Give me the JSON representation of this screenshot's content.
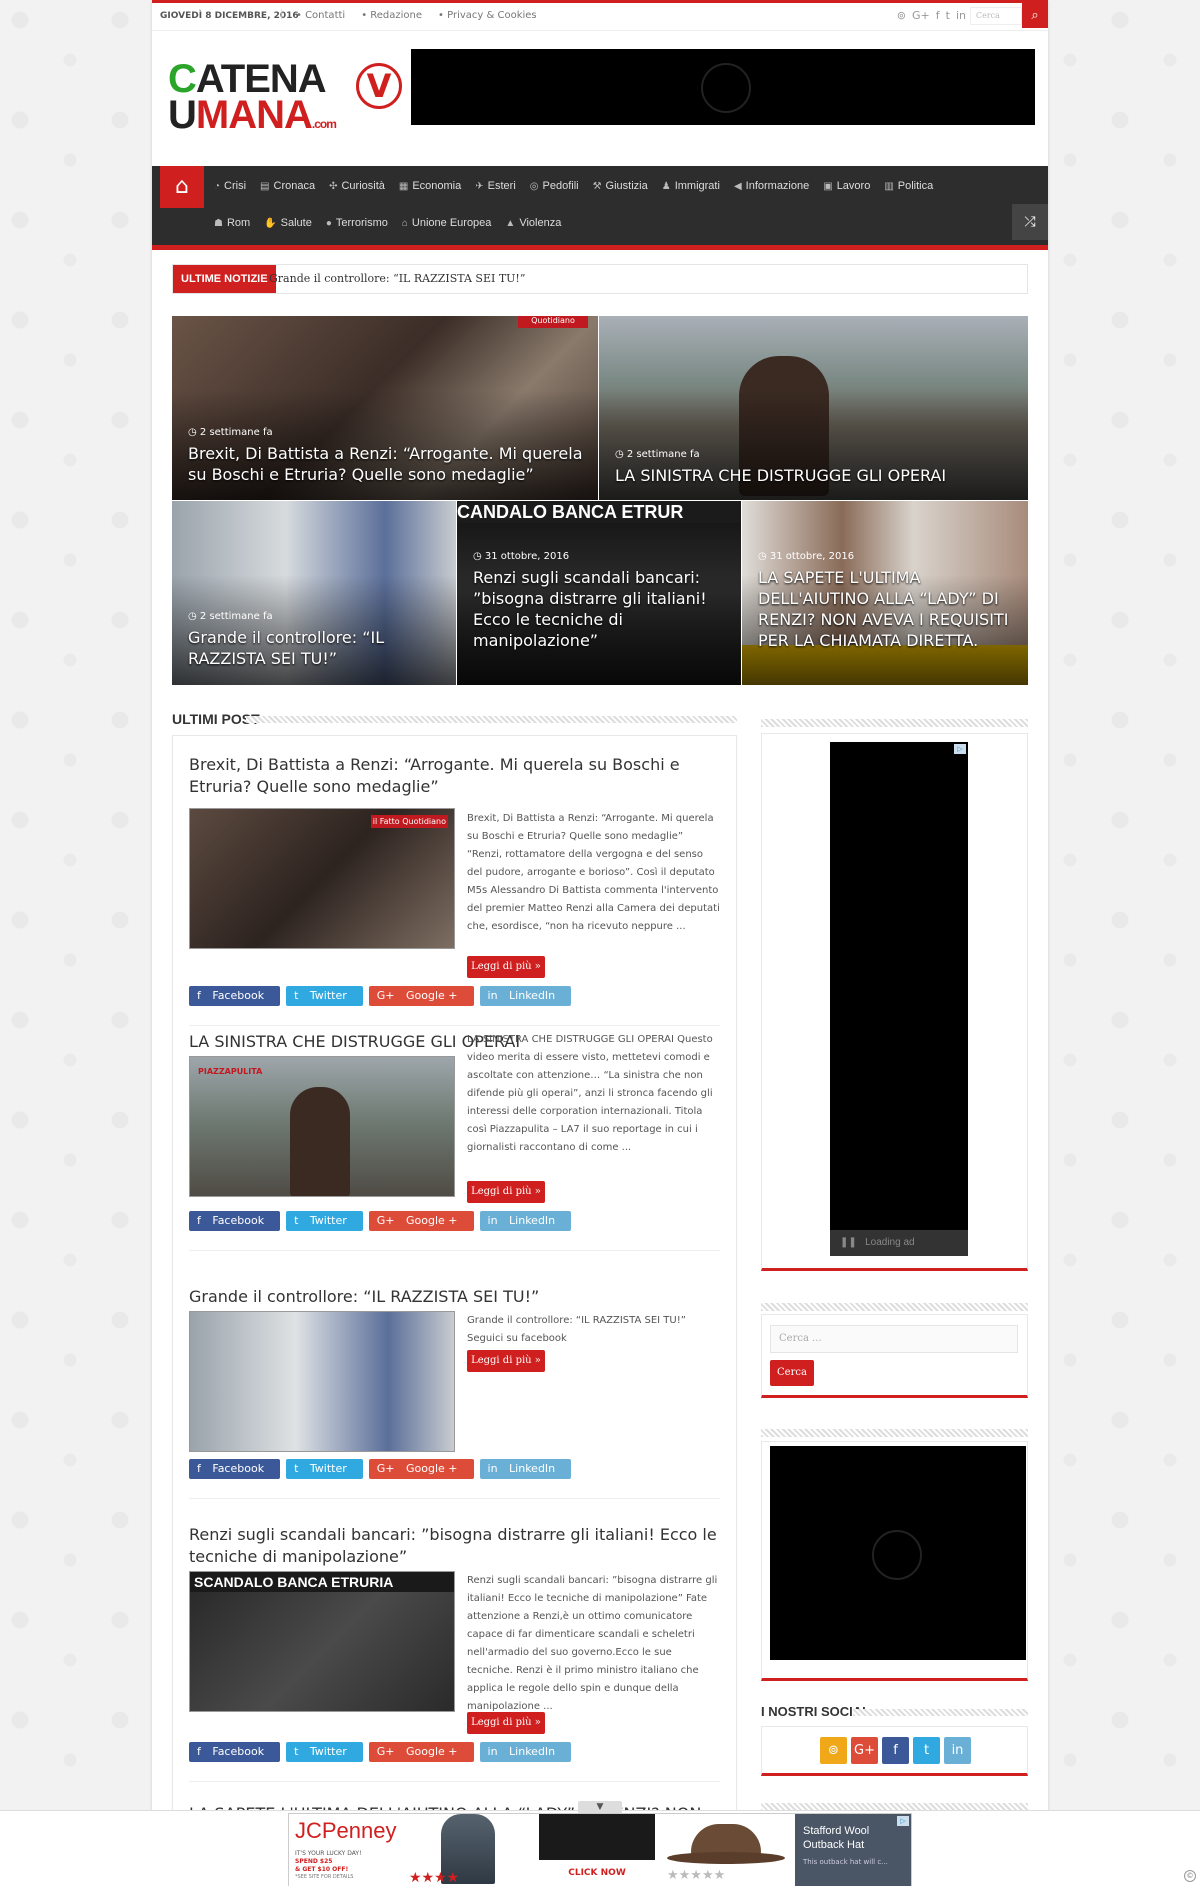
{
  "topbar": {
    "date": "GIOVEDÌ 8 DICEMBRE, 2016",
    "links": [
      "• Contatti",
      "• Redazione",
      "• Privacy & Cookies"
    ],
    "search_placeholder": "Cerca"
  },
  "logo": {
    "line1_prefix": "C",
    "line1_rest": "ATENA",
    "line2_prefix": "U",
    "line2_rest": "MANA",
    "suffix": ".com",
    "mark": "V"
  },
  "nav": {
    "row1": [
      {
        "icon": "pie-chart-icon",
        "label": "Crisi"
      },
      {
        "icon": "newspaper-icon",
        "label": "Cronaca"
      },
      {
        "icon": "puzzle-icon",
        "label": "Curiosità"
      },
      {
        "icon": "chart-icon",
        "label": "Economia"
      },
      {
        "icon": "plane-icon",
        "label": "Esteri"
      },
      {
        "icon": "gamepad-icon",
        "label": "Pedofili"
      },
      {
        "icon": "gavel-icon",
        "label": "Giustizia"
      },
      {
        "icon": "person-icon",
        "label": "Immigrati"
      },
      {
        "icon": "bullhorn-icon",
        "label": "Informazione"
      },
      {
        "icon": "briefcase-icon",
        "label": "Lavoro"
      },
      {
        "icon": "columns-icon",
        "label": "Politica"
      }
    ],
    "row2": [
      {
        "icon": "users-icon",
        "label": "Rom"
      },
      {
        "icon": "hand-icon",
        "label": "Salute"
      },
      {
        "icon": "bomb-icon",
        "label": "Terrorismo"
      },
      {
        "icon": "bank-icon",
        "label": "Unione Europea"
      },
      {
        "icon": "warning-icon",
        "label": "Violenza"
      }
    ]
  },
  "breaking": {
    "label": "ULTIME NOTIZIE",
    "text": "Grande il controllore: “IL RAZZISTA SEI TU!”"
  },
  "slider": [
    {
      "meta": "2 settimane fa",
      "title": "Brexit, Di Battista a Renzi: “Arrogante. Mi querela su Boschi e Etruria? Quelle sono medaglie”"
    },
    {
      "meta": "2 settimane fa",
      "title": "LA SINISTRA CHE DISTRUGGE GLI OPERAI"
    },
    {
      "meta": "2 settimane fa",
      "title": "Grande il controllore: “IL RAZZISTA SEI TU!”"
    },
    {
      "meta": "31 ottobre, 2016",
      "title": "Renzi sugli scandali bancari: ”bisogna distrarre gli italiani! Ecco le tecniche di manipolazione”"
    },
    {
      "meta": "31 ottobre, 2016",
      "title": "LA SAPETE L'ULTIMA DELL'AIUTINO ALLA “LADY” DI RENZI? NON AVEVA I REQUISITI PER LA CHIAMATA DIRETTA."
    }
  ],
  "ultimi": {
    "title": "ULTIMI POST",
    "more_label": "Leggi di più »",
    "share": {
      "facebook": "Facebook",
      "twitter": "Twitter",
      "google": "Google +",
      "linkedin": "LinkedIn"
    },
    "posts": [
      {
        "title": "Brexit, Di Battista a Renzi: “Arrogante. Mi querela su Boschi e Etruria? Quelle sono medaglie”",
        "excerpt": "Brexit, Di Battista a Renzi: “Arrogante. Mi querela su Boschi e Etruria? Quelle sono medaglie” “Renzi, rottamatore della vergogna e del senso del pudore, arrogante e borioso”. Così il deputato M5s Alessandro Di Battista commenta l'intervento del premier Matteo Renzi alla Camera dei deputati che, esordisce, “non ha ricevuto neppure ...",
        "thumb_caption": "il Fatto Quotidiano"
      },
      {
        "title": "LA SINISTRA CHE DISTRUGGE GLI OPERAI",
        "excerpt": "LA SINISTRA CHE DISTRUGGE GLI OPERAI Questo video merita di essere visto, mettetevi comodi e ascoltate con attenzione… “La sinistra che non difende più gli operai”, anzi li stronca facendo gli interessi delle corporation internazionali. Titola così Piazzapulita – LA7 il suo reportage in cui i giornalisti raccontano di come ...",
        "thumb_caption": "PIAZZAPULITA"
      },
      {
        "title": "Grande il controllore: “IL RAZZISTA SEI TU!”",
        "excerpt": "Grande il controllore: “IL RAZZISTA SEI TU!” Seguici su facebook",
        "thumb_caption": ""
      },
      {
        "title": "Renzi sugli scandali bancari: ”bisogna distrarre gli italiani! Ecco le tecniche di manipolazione”",
        "excerpt": "Renzi sugli scandali bancari: ”bisogna distrarre gli italiani! Ecco le tecniche di manipolazione” Fate attenzione a Renzi,è un ottimo comunicatore capace di far dimenticare scandali e scheletri nell'armadio del suo governo.Ecco le sue tecniche. Renzi è il primo ministro italiano che applica le regole dello spin e dunque della manipolazione ...",
        "thumb_caption": "SCANDALO BANCA ETRURIA"
      }
    ],
    "next_partial": "LA SAPETE L'ULTIMA DELL'AIUTINO ALLA “LADY” DI RENZI? NON"
  },
  "sidebar": {
    "ad_loading": "Loading ad",
    "search_placeholder": "Cerca ...",
    "search_button": "Cerca",
    "social_title": "I NOSTRI SOCIAL"
  },
  "bottom_ad": {
    "jcp_brand": "JCPenney",
    "jcp_l1": "IT'S YOUR LUCKY DAY!",
    "jcp_l2": "SPEND $25",
    "jcp_l3": "& GET $10 OFF!",
    "jcp_l4": "*SEE SITE FOR DETAILS",
    "cta": "CLICK NOW",
    "hat_name": "Stafford Wool Outback Hat",
    "hat_desc": "This outback hat will c..."
  },
  "colors": {
    "accent": "#d01f1f",
    "nav_bg": "#2d2d2d"
  }
}
